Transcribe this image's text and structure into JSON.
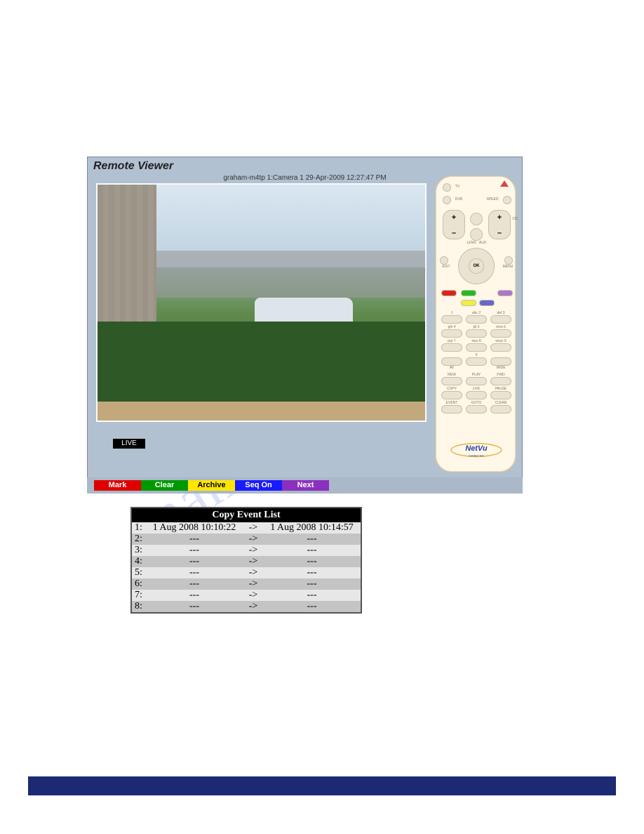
{
  "viewer": {
    "title": "Remote Viewer",
    "caption": "graham-m4tp 1:Camera 1 29-Apr-2009 12:27:47 PM",
    "live_label": "LIVE"
  },
  "softkeys": {
    "mark": "Mark",
    "clear": "Clear",
    "archive": "Archive",
    "seqon": "Seq On",
    "next": "Next"
  },
  "remote": {
    "labels": {
      "tv": "TV",
      "dvr": "DVR",
      "speed": "SPEED",
      "lens": "LENS",
      "aux": "AUX",
      "ch": "CH",
      "exit": "EXIT",
      "ok": "OK",
      "menu": "MENU",
      "keypad": [
        "1",
        "abc 2",
        "def 3",
        "ghi 4",
        "jkl 5",
        "mno 6",
        "pqr 7",
        "stuv 8",
        "wxyz 9",
        "AV",
        "0",
        "WIDE"
      ],
      "rew": "REW",
      "play": "PLAY",
      "fwd": "FWD",
      "copy": "COPY",
      "live": "LIVE",
      "pause": "PAUSE",
      "event": "EVENT",
      "goto": "GOTO",
      "clear": "CLEAR"
    },
    "brand": "NetVu",
    "brand_sub": "CONNECTED"
  },
  "event_list": {
    "title": "Copy Event List",
    "rows": [
      {
        "idx": "1:",
        "start": "1 Aug 2008 10:10:22",
        "arrow": "->",
        "end": "1 Aug 2008 10:14:57"
      },
      {
        "idx": "2:",
        "start": "---",
        "arrow": "->",
        "end": "---"
      },
      {
        "idx": "3:",
        "start": "---",
        "arrow": "->",
        "end": "---"
      },
      {
        "idx": "4:",
        "start": "---",
        "arrow": "->",
        "end": "---"
      },
      {
        "idx": "5:",
        "start": "---",
        "arrow": "->",
        "end": "---"
      },
      {
        "idx": "6:",
        "start": "---",
        "arrow": "->",
        "end": "---"
      },
      {
        "idx": "7:",
        "start": "---",
        "arrow": "->",
        "end": "---"
      },
      {
        "idx": "8:",
        "start": "---",
        "arrow": "->",
        "end": "---"
      }
    ]
  },
  "watermark": "manualshive.com"
}
